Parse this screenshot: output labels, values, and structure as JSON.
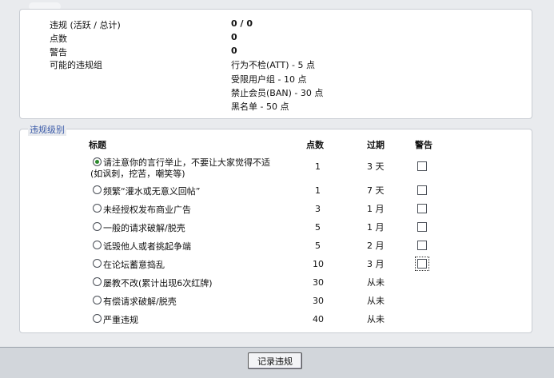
{
  "summary": {
    "rows": [
      {
        "label": "违规 (活跃 / 总计)",
        "value": "0 / 0"
      },
      {
        "label": "点数",
        "value": "0"
      },
      {
        "label": "警告",
        "value": "0"
      },
      {
        "label": "可能的违规组",
        "value": "行为不检(ATT) - 5 点"
      }
    ],
    "extra_groups": [
      "受限用户组 - 10 点",
      "禁止会员(BAN) - 30 点",
      "黑名单 - 50 点"
    ]
  },
  "levels": {
    "legend": "违规级别",
    "headers": {
      "title": "标题",
      "points": "点数",
      "expires": "过期",
      "warn": "警告"
    },
    "rows": [
      {
        "title_line1": "请注意你的言行举止，不要让大家觉得不适",
        "title_line2": "(如讽刺，挖苦，嘲笑等)",
        "points": "1",
        "expires": "3 天",
        "selected": true,
        "has_warn": true
      },
      {
        "title_line1": "频繁“灌水或无意义回帖”",
        "points": "1",
        "expires": "7 天",
        "selected": false,
        "has_warn": true
      },
      {
        "title_line1": "未经授权发布商业广告",
        "points": "3",
        "expires": "1 月",
        "selected": false,
        "has_warn": true
      },
      {
        "title_line1": "一般的请求破解/脱壳",
        "points": "5",
        "expires": "1 月",
        "selected": false,
        "has_warn": true
      },
      {
        "title_line1": "诋毁他人或者挑起争端",
        "points": "5",
        "expires": "2 月",
        "selected": false,
        "has_warn": true
      },
      {
        "title_line1": "在论坛蓄意捣乱",
        "points": "10",
        "expires": "3 月",
        "selected": false,
        "has_warn": true
      },
      {
        "title_line1": "屡教不改(累计出现6次红牌)",
        "points": "30",
        "expires": "从未",
        "selected": false,
        "has_warn": false
      },
      {
        "title_line1": "有偿请求破解/脱壳",
        "points": "30",
        "expires": "从未",
        "selected": false,
        "has_warn": false
      },
      {
        "title_line1": "严重违规",
        "points": "40",
        "expires": "从未",
        "selected": false,
        "has_warn": false
      }
    ]
  },
  "footer": {
    "submit_label": "记录违规"
  }
}
